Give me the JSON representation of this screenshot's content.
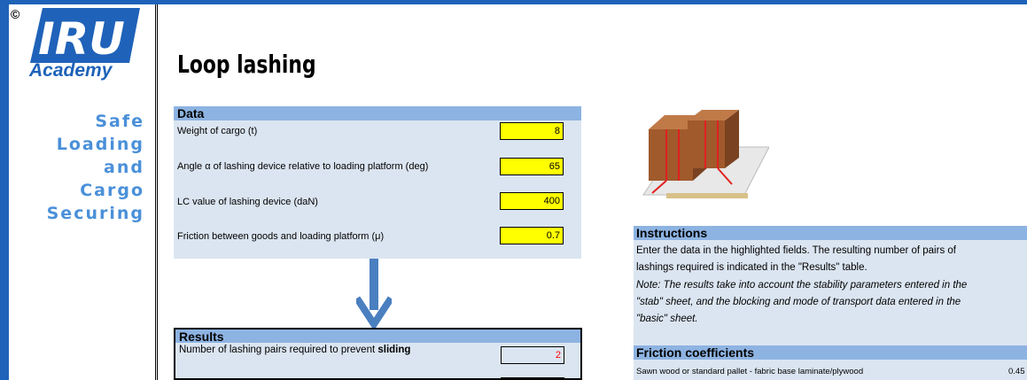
{
  "branding": {
    "copyright": "©",
    "logo_text": "IRU",
    "logo_sub": "Academy",
    "tagline": [
      "Safe",
      "Loading",
      "and",
      "Cargo",
      "Securing"
    ]
  },
  "page": {
    "title": "Loop lashing"
  },
  "data_panel": {
    "heading": "Data",
    "rows": [
      {
        "label": "Weight of cargo (t)",
        "value": "8"
      },
      {
        "label": "Angle α of lashing device relative to loading platform (deg)",
        "value": "65"
      },
      {
        "label": "LC value of lashing device (daN)",
        "value": "400"
      },
      {
        "label": "Friction between goods and loading platform (μ)",
        "value": "0.7"
      }
    ]
  },
  "results_panel": {
    "heading": "Results",
    "rows": [
      {
        "label_prefix": "Number of lashing pairs required to prevent ",
        "label_bold": "sliding",
        "value": "2"
      }
    ]
  },
  "instructions": {
    "heading": "Instructions",
    "line1": "Enter the data in the highlighted fields. The resulting number of pairs of",
    "line2": "lashings required is indicated in the \"Results\" table.",
    "note1": "Note: The results take into account the stability parameters entered in the",
    "note2": "\"stab\" sheet, and the blocking and mode of transport data entered in the",
    "note3": "\"basic\" sheet."
  },
  "friction": {
    "heading": "Friction coefficients",
    "rows": [
      {
        "label": "Sawn wood or standard pallet - fabric base laminate/plywood",
        "value": "0.45"
      }
    ]
  },
  "colors": {
    "brand_blue": "#1f62b9",
    "panel_bg": "#dbe5f1",
    "panel_head": "#8db3e2",
    "input_yellow": "#ffff00",
    "result_red": "#ff0000"
  }
}
